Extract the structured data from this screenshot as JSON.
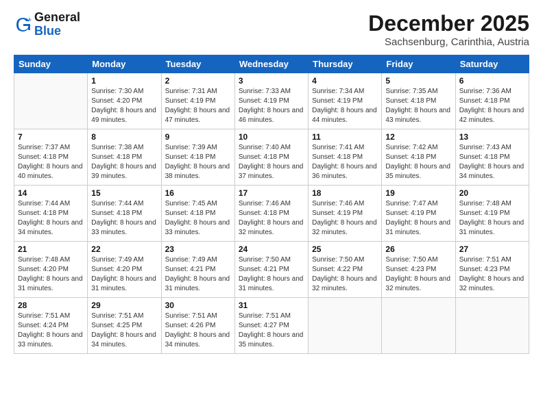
{
  "logo": {
    "line1": "General",
    "line2": "Blue"
  },
  "title": "December 2025",
  "location": "Sachsenburg, Carinthia, Austria",
  "days_of_week": [
    "Sunday",
    "Monday",
    "Tuesday",
    "Wednesday",
    "Thursday",
    "Friday",
    "Saturday"
  ],
  "weeks": [
    [
      {
        "day": "",
        "sunrise": "",
        "sunset": "",
        "daylight": ""
      },
      {
        "day": "1",
        "sunrise": "Sunrise: 7:30 AM",
        "sunset": "Sunset: 4:20 PM",
        "daylight": "Daylight: 8 hours and 49 minutes."
      },
      {
        "day": "2",
        "sunrise": "Sunrise: 7:31 AM",
        "sunset": "Sunset: 4:19 PM",
        "daylight": "Daylight: 8 hours and 47 minutes."
      },
      {
        "day": "3",
        "sunrise": "Sunrise: 7:33 AM",
        "sunset": "Sunset: 4:19 PM",
        "daylight": "Daylight: 8 hours and 46 minutes."
      },
      {
        "day": "4",
        "sunrise": "Sunrise: 7:34 AM",
        "sunset": "Sunset: 4:19 PM",
        "daylight": "Daylight: 8 hours and 44 minutes."
      },
      {
        "day": "5",
        "sunrise": "Sunrise: 7:35 AM",
        "sunset": "Sunset: 4:18 PM",
        "daylight": "Daylight: 8 hours and 43 minutes."
      },
      {
        "day": "6",
        "sunrise": "Sunrise: 7:36 AM",
        "sunset": "Sunset: 4:18 PM",
        "daylight": "Daylight: 8 hours and 42 minutes."
      }
    ],
    [
      {
        "day": "7",
        "sunrise": "Sunrise: 7:37 AM",
        "sunset": "Sunset: 4:18 PM",
        "daylight": "Daylight: 8 hours and 40 minutes."
      },
      {
        "day": "8",
        "sunrise": "Sunrise: 7:38 AM",
        "sunset": "Sunset: 4:18 PM",
        "daylight": "Daylight: 8 hours and 39 minutes."
      },
      {
        "day": "9",
        "sunrise": "Sunrise: 7:39 AM",
        "sunset": "Sunset: 4:18 PM",
        "daylight": "Daylight: 8 hours and 38 minutes."
      },
      {
        "day": "10",
        "sunrise": "Sunrise: 7:40 AM",
        "sunset": "Sunset: 4:18 PM",
        "daylight": "Daylight: 8 hours and 37 minutes."
      },
      {
        "day": "11",
        "sunrise": "Sunrise: 7:41 AM",
        "sunset": "Sunset: 4:18 PM",
        "daylight": "Daylight: 8 hours and 36 minutes."
      },
      {
        "day": "12",
        "sunrise": "Sunrise: 7:42 AM",
        "sunset": "Sunset: 4:18 PM",
        "daylight": "Daylight: 8 hours and 35 minutes."
      },
      {
        "day": "13",
        "sunrise": "Sunrise: 7:43 AM",
        "sunset": "Sunset: 4:18 PM",
        "daylight": "Daylight: 8 hours and 34 minutes."
      }
    ],
    [
      {
        "day": "14",
        "sunrise": "Sunrise: 7:44 AM",
        "sunset": "Sunset: 4:18 PM",
        "daylight": "Daylight: 8 hours and 34 minutes."
      },
      {
        "day": "15",
        "sunrise": "Sunrise: 7:44 AM",
        "sunset": "Sunset: 4:18 PM",
        "daylight": "Daylight: 8 hours and 33 minutes."
      },
      {
        "day": "16",
        "sunrise": "Sunrise: 7:45 AM",
        "sunset": "Sunset: 4:18 PM",
        "daylight": "Daylight: 8 hours and 33 minutes."
      },
      {
        "day": "17",
        "sunrise": "Sunrise: 7:46 AM",
        "sunset": "Sunset: 4:18 PM",
        "daylight": "Daylight: 8 hours and 32 minutes."
      },
      {
        "day": "18",
        "sunrise": "Sunrise: 7:46 AM",
        "sunset": "Sunset: 4:19 PM",
        "daylight": "Daylight: 8 hours and 32 minutes."
      },
      {
        "day": "19",
        "sunrise": "Sunrise: 7:47 AM",
        "sunset": "Sunset: 4:19 PM",
        "daylight": "Daylight: 8 hours and 31 minutes."
      },
      {
        "day": "20",
        "sunrise": "Sunrise: 7:48 AM",
        "sunset": "Sunset: 4:19 PM",
        "daylight": "Daylight: 8 hours and 31 minutes."
      }
    ],
    [
      {
        "day": "21",
        "sunrise": "Sunrise: 7:48 AM",
        "sunset": "Sunset: 4:20 PM",
        "daylight": "Daylight: 8 hours and 31 minutes."
      },
      {
        "day": "22",
        "sunrise": "Sunrise: 7:49 AM",
        "sunset": "Sunset: 4:20 PM",
        "daylight": "Daylight: 8 hours and 31 minutes."
      },
      {
        "day": "23",
        "sunrise": "Sunrise: 7:49 AM",
        "sunset": "Sunset: 4:21 PM",
        "daylight": "Daylight: 8 hours and 31 minutes."
      },
      {
        "day": "24",
        "sunrise": "Sunrise: 7:50 AM",
        "sunset": "Sunset: 4:21 PM",
        "daylight": "Daylight: 8 hours and 31 minutes."
      },
      {
        "day": "25",
        "sunrise": "Sunrise: 7:50 AM",
        "sunset": "Sunset: 4:22 PM",
        "daylight": "Daylight: 8 hours and 32 minutes."
      },
      {
        "day": "26",
        "sunrise": "Sunrise: 7:50 AM",
        "sunset": "Sunset: 4:23 PM",
        "daylight": "Daylight: 8 hours and 32 minutes."
      },
      {
        "day": "27",
        "sunrise": "Sunrise: 7:51 AM",
        "sunset": "Sunset: 4:23 PM",
        "daylight": "Daylight: 8 hours and 32 minutes."
      }
    ],
    [
      {
        "day": "28",
        "sunrise": "Sunrise: 7:51 AM",
        "sunset": "Sunset: 4:24 PM",
        "daylight": "Daylight: 8 hours and 33 minutes."
      },
      {
        "day": "29",
        "sunrise": "Sunrise: 7:51 AM",
        "sunset": "Sunset: 4:25 PM",
        "daylight": "Daylight: 8 hours and 34 minutes."
      },
      {
        "day": "30",
        "sunrise": "Sunrise: 7:51 AM",
        "sunset": "Sunset: 4:26 PM",
        "daylight": "Daylight: 8 hours and 34 minutes."
      },
      {
        "day": "31",
        "sunrise": "Sunrise: 7:51 AM",
        "sunset": "Sunset: 4:27 PM",
        "daylight": "Daylight: 8 hours and 35 minutes."
      },
      {
        "day": "",
        "sunrise": "",
        "sunset": "",
        "daylight": ""
      },
      {
        "day": "",
        "sunrise": "",
        "sunset": "",
        "daylight": ""
      },
      {
        "day": "",
        "sunrise": "",
        "sunset": "",
        "daylight": ""
      }
    ]
  ]
}
